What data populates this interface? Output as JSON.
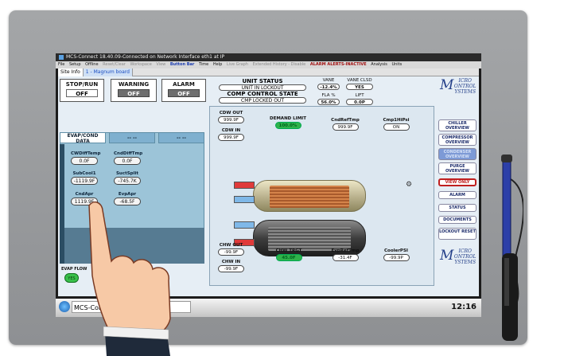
{
  "window": {
    "title": "MCS-Connect 18.40.09-Connected on Network Interface eth1 at IP"
  },
  "menubar": {
    "items": [
      "File",
      "Setup",
      "Offline",
      "Reset/Clear",
      "Workspace",
      "View",
      "Button Bar",
      "Time",
      "Help",
      "Live Graph",
      "Extended History - Disable",
      "ALARM ALERTS-INACTIVE",
      "Analysis",
      "Units"
    ]
  },
  "tabs": {
    "site_info": "Site Info",
    "board": "1 - Magnum board"
  },
  "top": {
    "stop_run": {
      "label": "STOP/RUN",
      "value": "OFF"
    },
    "warning": {
      "label": "WARNING",
      "value": "OFF"
    },
    "alarm": {
      "label": "ALARM",
      "value": "OFF"
    }
  },
  "status": {
    "unit_status_label": "UNIT STATUS",
    "unit_status_value": "UNIT IN LOCKOUT",
    "comp_control_label": "COMP CONTROL STATE",
    "comp_control_value": "CMP LOCKED OUT"
  },
  "readings": {
    "vane": {
      "label": "VANE",
      "value": "-12.4%"
    },
    "vane_clsd": {
      "label": "VANE CLSD",
      "value": "YES"
    },
    "fla": {
      "label": "FLA %",
      "value": "56.0%"
    },
    "lift": {
      "label": "LIFT",
      "value": "0.0P"
    }
  },
  "logo": {
    "line1": "ICRO",
    "line2": "ONTROL",
    "line3": "YSTEMS"
  },
  "side_buttons": [
    {
      "label": "CHILLER OVERVIEW"
    },
    {
      "label": "COMPRESSOR OVERVIEW"
    },
    {
      "label": "CONDENSER OVERVIEW"
    },
    {
      "label": "PURGE OVERVIEW"
    },
    {
      "label": "VIEW ONLY"
    },
    {
      "label": "ALARM"
    },
    {
      "label": "STATUS"
    },
    {
      "label": "DOCUMENTS"
    },
    {
      "label": "LOCKOUT RESET"
    }
  ],
  "left_panel": {
    "tab_label": "EVAP/COND DATA",
    "tab2": "-- --",
    "tab3": "-- --",
    "values": [
      {
        "label": "CWDiffTemp",
        "value": "0.0F"
      },
      {
        "label": "CndDiffTmp",
        "value": "0.0F"
      },
      {
        "label": "SubCool1",
        "value": "-1119.9F"
      },
      {
        "label": "SuctSplit",
        "value": "-745.7K"
      },
      {
        "label": "CndApr",
        "value": "1119.9F"
      },
      {
        "label": "EvpApr",
        "value": "-68.5F"
      }
    ],
    "evap_flow_label": "EVAP FLOW",
    "evap_flow_value": "YES"
  },
  "center": {
    "cdw_out": {
      "label": "CDW OUT",
      "value": "999.9F"
    },
    "cdw_in": {
      "label": "CDW IN",
      "value": "999.9F"
    },
    "demand_limit": {
      "label": "DEMAND LIMIT",
      "value": "100.0%"
    },
    "cnd_ref_tmp": {
      "label": "CndRefTmp",
      "value": "999.9F"
    },
    "cmp1_hi_psi": {
      "label": "Cmp1HiPsi",
      "value": "ON"
    },
    "chw_out": {
      "label": "CHW OUT",
      "value": "-99.9F"
    },
    "chw_in": {
      "label": "CHW IN",
      "value": "-99.9F"
    },
    "chw_trgt": {
      "label": "CHW TRGT",
      "value": "45.0F"
    },
    "evp_ref_tmp": {
      "label": "EvpRefTmp",
      "value": "-31.4F"
    },
    "cooler_psi": {
      "label": "CoolerPSI",
      "value": "-99.9P"
    }
  },
  "taskbar": {
    "task_label": "MCS-Con",
    "clock": "12:16"
  },
  "colors": {
    "accent": "#2fb34a",
    "panel": "#9cc4d8",
    "bezel": "#9a9c9f"
  }
}
